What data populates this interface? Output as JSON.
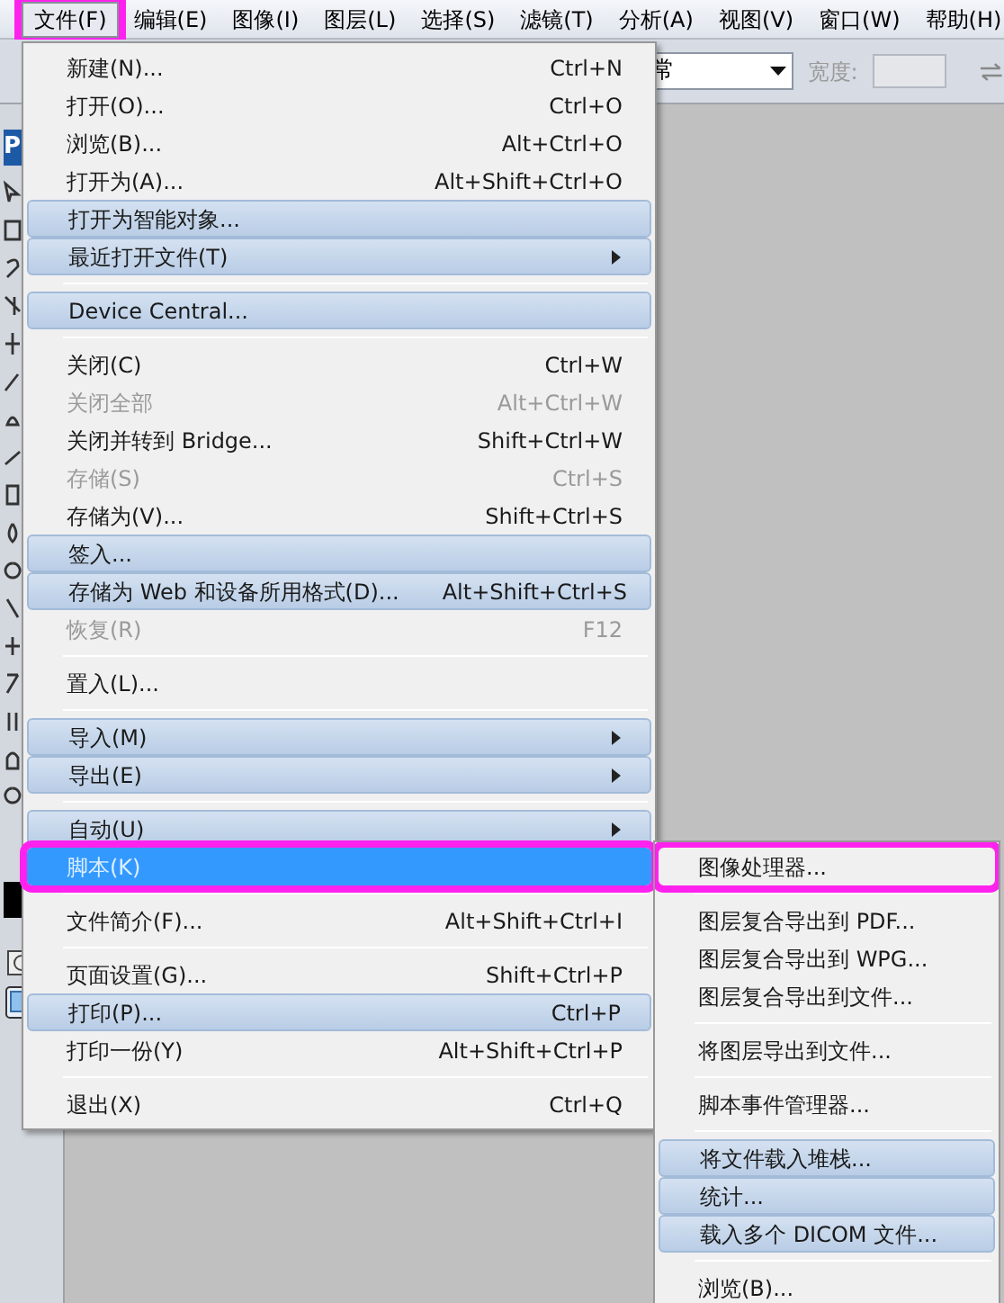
{
  "menubar": [
    {
      "label": "文件(F)",
      "selected": true,
      "outlined": true
    },
    {
      "label": "编辑(E)",
      "selected": false,
      "outlined": false
    },
    {
      "label": "图像(I)",
      "selected": false,
      "outlined": false
    },
    {
      "label": "图层(L)",
      "selected": false,
      "outlined": false
    },
    {
      "label": "选择(S)",
      "selected": false,
      "outlined": false
    },
    {
      "label": "滤镜(T)",
      "selected": false,
      "outlined": false
    },
    {
      "label": "分析(A)",
      "selected": false,
      "outlined": false
    },
    {
      "label": "视图(V)",
      "selected": false,
      "outlined": false
    },
    {
      "label": "窗口(W)",
      "selected": false,
      "outlined": false
    },
    {
      "label": "帮助(H)",
      "selected": false,
      "outlined": false
    }
  ],
  "options_bar": {
    "mode_value": "常",
    "width_label": "宽度:"
  },
  "logo": "P",
  "file_menu": [
    {
      "kind": "item",
      "label": "新建(N)...",
      "shortcut": "Ctrl+N",
      "disabled": false,
      "shaded": false,
      "submenu": false,
      "selected": false,
      "outlined": false
    },
    {
      "kind": "item",
      "label": "打开(O)...",
      "shortcut": "Ctrl+O",
      "disabled": false,
      "shaded": false,
      "submenu": false,
      "selected": false,
      "outlined": false
    },
    {
      "kind": "item",
      "label": "浏览(B)...",
      "shortcut": "Alt+Ctrl+O",
      "disabled": false,
      "shaded": false,
      "submenu": false,
      "selected": false,
      "outlined": false
    },
    {
      "kind": "item",
      "label": "打开为(A)...",
      "shortcut": "Alt+Shift+Ctrl+O",
      "disabled": false,
      "shaded": false,
      "submenu": false,
      "selected": false,
      "outlined": false
    },
    {
      "kind": "item",
      "label": "打开为智能对象...",
      "disabled": false,
      "shaded": true,
      "submenu": false,
      "selected": false,
      "outlined": false
    },
    {
      "kind": "item",
      "label": "最近打开文件(T)",
      "disabled": false,
      "shaded": true,
      "submenu": true,
      "selected": false,
      "outlined": false
    },
    {
      "kind": "separator"
    },
    {
      "kind": "item",
      "label": "Device Central...",
      "disabled": false,
      "shaded": true,
      "submenu": false,
      "selected": false,
      "outlined": false
    },
    {
      "kind": "separator"
    },
    {
      "kind": "item",
      "label": "关闭(C)",
      "shortcut": "Ctrl+W",
      "disabled": false,
      "shaded": false,
      "submenu": false,
      "selected": false,
      "outlined": false
    },
    {
      "kind": "item",
      "label": "关闭全部",
      "shortcut": "Alt+Ctrl+W",
      "disabled": true,
      "shaded": false,
      "submenu": false,
      "selected": false,
      "outlined": false
    },
    {
      "kind": "item",
      "label": "关闭并转到 Bridge...",
      "shortcut": "Shift+Ctrl+W",
      "disabled": false,
      "shaded": false,
      "submenu": false,
      "selected": false,
      "outlined": false
    },
    {
      "kind": "item",
      "label": "存储(S)",
      "shortcut": "Ctrl+S",
      "disabled": true,
      "shaded": false,
      "submenu": false,
      "selected": false,
      "outlined": false
    },
    {
      "kind": "item",
      "label": "存储为(V)...",
      "shortcut": "Shift+Ctrl+S",
      "disabled": false,
      "shaded": false,
      "submenu": false,
      "selected": false,
      "outlined": false
    },
    {
      "kind": "item",
      "label": "签入...",
      "disabled": false,
      "shaded": true,
      "submenu": false,
      "selected": false,
      "outlined": false
    },
    {
      "kind": "item",
      "label": "存储为 Web 和设备所用格式(D)...",
      "shortcut": "Alt+Shift+Ctrl+S",
      "disabled": false,
      "shaded": true,
      "submenu": false,
      "selected": false,
      "outlined": false
    },
    {
      "kind": "item",
      "label": "恢复(R)",
      "shortcut": "F12",
      "disabled": true,
      "shaded": false,
      "submenu": false,
      "selected": false,
      "outlined": false
    },
    {
      "kind": "separator"
    },
    {
      "kind": "item",
      "label": "置入(L)...",
      "disabled": false,
      "shaded": false,
      "submenu": false,
      "selected": false,
      "outlined": false
    },
    {
      "kind": "separator"
    },
    {
      "kind": "item",
      "label": "导入(M)",
      "disabled": false,
      "shaded": true,
      "submenu": true,
      "selected": false,
      "outlined": false
    },
    {
      "kind": "item",
      "label": "导出(E)",
      "disabled": false,
      "shaded": true,
      "submenu": true,
      "selected": false,
      "outlined": false
    },
    {
      "kind": "separator"
    },
    {
      "kind": "item",
      "label": "自动(U)",
      "disabled": false,
      "shaded": true,
      "submenu": true,
      "selected": false,
      "outlined": false
    },
    {
      "kind": "item",
      "label": "脚本(K)",
      "disabled": false,
      "shaded": false,
      "submenu": false,
      "selected": true,
      "outlined": true
    },
    {
      "kind": "separator"
    },
    {
      "kind": "item",
      "label": "文件简介(F)...",
      "shortcut": "Alt+Shift+Ctrl+I",
      "disabled": false,
      "shaded": false,
      "submenu": false,
      "selected": false,
      "outlined": false
    },
    {
      "kind": "separator"
    },
    {
      "kind": "item",
      "label": "页面设置(G)...",
      "shortcut": "Shift+Ctrl+P",
      "disabled": false,
      "shaded": false,
      "submenu": false,
      "selected": false,
      "outlined": false
    },
    {
      "kind": "item",
      "label": "打印(P)...",
      "shortcut": "Ctrl+P",
      "disabled": false,
      "shaded": true,
      "submenu": false,
      "selected": false,
      "outlined": false
    },
    {
      "kind": "item",
      "label": "打印一份(Y)",
      "shortcut": "Alt+Shift+Ctrl+P",
      "disabled": false,
      "shaded": false,
      "submenu": false,
      "selected": false,
      "outlined": false
    },
    {
      "kind": "separator"
    },
    {
      "kind": "item",
      "label": "退出(X)",
      "shortcut": "Ctrl+Q",
      "disabled": false,
      "shaded": false,
      "submenu": false,
      "selected": false,
      "outlined": false
    }
  ],
  "scripts_submenu": [
    {
      "kind": "item",
      "label": "图像处理器...",
      "shaded": false,
      "outlined": true
    },
    {
      "kind": "separator"
    },
    {
      "kind": "item",
      "label": "图层复合导出到 PDF...",
      "shaded": false,
      "outlined": false
    },
    {
      "kind": "item",
      "label": "图层复合导出到 WPG...",
      "shaded": false,
      "outlined": false
    },
    {
      "kind": "item",
      "label": "图层复合导出到文件...",
      "shaded": false,
      "outlined": false
    },
    {
      "kind": "separator"
    },
    {
      "kind": "item",
      "label": "将图层导出到文件...",
      "shaded": false,
      "outlined": false
    },
    {
      "kind": "separator"
    },
    {
      "kind": "item",
      "label": "脚本事件管理器...",
      "shaded": false,
      "outlined": false
    },
    {
      "kind": "separator"
    },
    {
      "kind": "item",
      "label": "将文件载入堆栈...",
      "shaded": true,
      "outlined": false
    },
    {
      "kind": "item",
      "label": "统计...",
      "shaded": true,
      "outlined": false
    },
    {
      "kind": "item",
      "label": "载入多个 DICOM 文件...",
      "shaded": true,
      "outlined": false
    },
    {
      "kind": "separator"
    },
    {
      "kind": "item",
      "label": "浏览(B)...",
      "shaded": false,
      "outlined": false
    }
  ]
}
